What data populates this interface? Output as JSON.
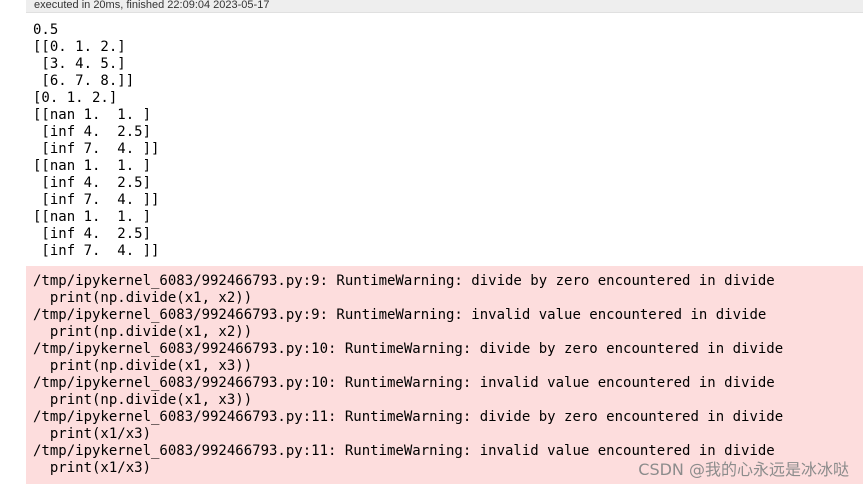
{
  "execution": {
    "status_text": "executed in 20ms, finished 22:09:04 2023-05-17"
  },
  "output": {
    "stdout_lines": [
      "0.5",
      "[[0. 1. 2.]",
      " [3. 4. 5.]",
      " [6. 7. 8.]]",
      "[0. 1. 2.]",
      "[[nan 1.  1. ]",
      " [inf 4.  2.5]",
      " [inf 7.  4. ]]",
      "[[nan 1.  1. ]",
      " [inf 4.  2.5]",
      " [inf 7.  4. ]]",
      "[[nan 1.  1. ]",
      " [inf 4.  2.5]",
      " [inf 7.  4. ]]"
    ],
    "stderr_lines": [
      "/tmp/ipykernel_6083/992466793.py:9: RuntimeWarning: divide by zero encountered in divide",
      "  print(np.divide(x1, x2))",
      "/tmp/ipykernel_6083/992466793.py:9: RuntimeWarning: invalid value encountered in divide",
      "  print(np.divide(x1, x2))",
      "/tmp/ipykernel_6083/992466793.py:10: RuntimeWarning: divide by zero encountered in divide",
      "  print(np.divide(x1, x3))",
      "/tmp/ipykernel_6083/992466793.py:10: RuntimeWarning: invalid value encountered in divide",
      "  print(np.divide(x1, x3))",
      "/tmp/ipykernel_6083/992466793.py:11: RuntimeWarning: divide by zero encountered in divide",
      "  print(x1/x3)",
      "/tmp/ipykernel_6083/992466793.py:11: RuntimeWarning: invalid value encountered in divide",
      "  print(x1/x3)"
    ],
    "stderr_background": "#fddddd"
  },
  "watermark": {
    "text": "CSDN @我的心永远是冰冰哒"
  }
}
